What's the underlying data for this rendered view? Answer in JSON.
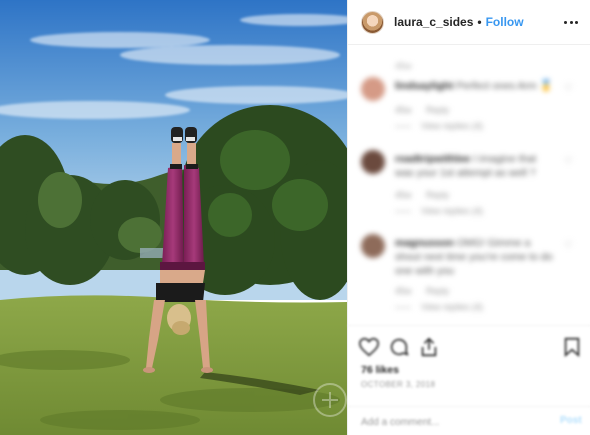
{
  "post": {
    "username": "laura_c_sides",
    "separator": "•",
    "follow_label": "Follow"
  },
  "comments": {
    "top_timestamp": "45w",
    "items": [
      {
        "username": "lindsaylight",
        "text": "Perfect ones Arm",
        "emoji": "🥇",
        "time": "45w",
        "reply_label": "Reply",
        "view_replies": "View replies (4)"
      },
      {
        "username": "roadtripwithlee",
        "text": "I imagine that was your 1st attempt as well ?",
        "emoji": "",
        "time": "45w",
        "reply_label": "Reply",
        "view_replies": "View replies (4)"
      },
      {
        "username": "magnusson",
        "text": "OMG! Gimme a shout next time you’re come to do one with you",
        "emoji": "",
        "time": "45w",
        "reply_label": "Reply",
        "view_replies": "View replies (4)"
      }
    ]
  },
  "actions": {
    "likes": "76 likes",
    "date": "OCTOBER 3, 2018",
    "add_comment_placeholder": "Add a comment...",
    "post_label": "Post"
  },
  "icons": [
    "more-options-icon",
    "heart-icon",
    "comment-icon",
    "share-icon",
    "bookmark-icon"
  ],
  "colors": {
    "follow": "#3897f0",
    "post_disabled": "#b2dffc",
    "border": "#efefef"
  }
}
